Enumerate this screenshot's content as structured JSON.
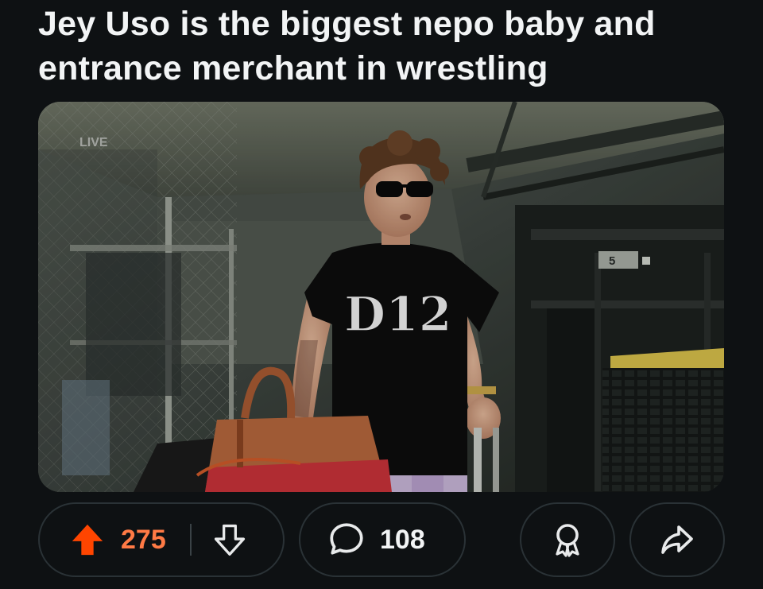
{
  "post": {
    "title": "Jey Uso is the biggest nepo baby and entrance merchant in wrestling"
  },
  "media": {
    "broadcast_bug": "LIVE",
    "shirt_logo": "D12",
    "bin_label": "5"
  },
  "actions": {
    "upvote_count": "275",
    "comment_count": "108",
    "upvote_color": "#ff4500",
    "count_color": "#ff7a45",
    "icons": [
      "upvote-icon",
      "downvote-icon",
      "comment-icon",
      "award-icon",
      "share-icon"
    ]
  }
}
